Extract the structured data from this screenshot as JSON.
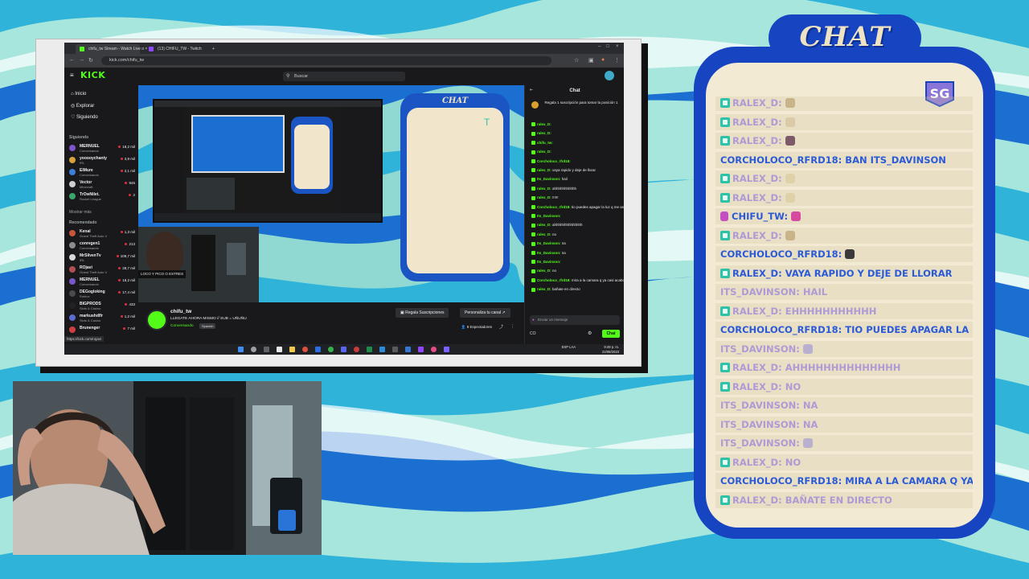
{
  "colors": {
    "accent": "#53fc18",
    "chat_blue": "#1745c2",
    "chat_cream": "#f2ead3",
    "name_blue": "#2b5ad6",
    "name_faded": "#ae9ad4"
  },
  "browser": {
    "tabs": [
      {
        "label": "chifu_tw Stream - Watch Live o ×",
        "icon": "kick-tab-icon"
      },
      {
        "label": "(13) CHIFU_TW - Twitch",
        "icon": "twitch-tab-icon"
      }
    ],
    "new_tab": "+",
    "url": "kick.com/chifu_tw",
    "status_url": "https://kick.com/rojavi"
  },
  "kick": {
    "logo": "KICK",
    "search_placeholder": "Buscar",
    "menu_main": [
      "Inicio",
      "Explorar",
      "Siguiendo"
    ],
    "following_heading": "Siguiendo",
    "following": [
      {
        "name": "MERNUEL",
        "game": "Conversando",
        "viewers": "18,2 mil",
        "color": "#7a56c8"
      },
      {
        "name": "yooooychanty",
        "game": "IRL",
        "viewers": "3,9 mil",
        "color": "#d8a23a"
      },
      {
        "name": "ElMure",
        "game": "Conversando",
        "viewers": "2,1 mil",
        "color": "#3e7dd8"
      },
      {
        "name": "Vector",
        "game": "Minecraft",
        "viewers": "945",
        "color": "#cfcfcf"
      },
      {
        "name": "TrOwNilet.",
        "game": "Rocket League",
        "viewers": "2",
        "color": "#3aa86a"
      }
    ],
    "show_more": "Mostrar más",
    "recommended_heading": "Recomendado",
    "recommended": [
      {
        "name": "Kenal",
        "game": "Grand Theft Auto V",
        "viewers": "1,3 mil",
        "color": "#c8563d"
      },
      {
        "name": "conregen1",
        "game": "Conversando",
        "viewers": "213",
        "color": "#8d8d8d"
      },
      {
        "name": "MrSilvenTv",
        "game": "IRL",
        "viewers": "109,7 mil",
        "color": "#d8d8d8"
      },
      {
        "name": "ROjavi",
        "game": "Grand Theft Auto V",
        "viewers": "28,7 mil",
        "color": "#b05050"
      },
      {
        "name": "MERNUEL",
        "game": "Conversando",
        "viewers": "18,2 mil",
        "color": "#7a56c8"
      },
      {
        "name": "DEGogloking",
        "game": "Roblox",
        "viewers": "17,4 mil",
        "color": "#4a4a4a"
      },
      {
        "name": "BIGPRODS",
        "game": "Slots & Casino",
        "viewers": "433",
        "color": "#222222"
      },
      {
        "name": "markushdlfr",
        "game": "Slots & Casino",
        "viewers": "1,2 mil",
        "color": "#5b6bd0"
      },
      {
        "name": "Brunenger",
        "game": "",
        "viewers": "7 mil",
        "color": "#d04040"
      }
    ],
    "overlay_label": "LOCO Y PICO O ESTRES",
    "channel": {
      "name": "chifu_tw",
      "title": "LLEGATE AHORA MISMO // SUB = UÑUÑU",
      "category": "Conversando",
      "tag": "Spanish",
      "viewers": "8 Espectadores"
    },
    "buttons": {
      "gift": "Regala Suscripciones",
      "customize": "Personaliza tu canal"
    },
    "chat": {
      "title": "Chat",
      "pinned": "Regala 1 suscripción para tomar la posición 1",
      "messages": [
        {
          "user": "ralex_D:",
          "text": ""
        },
        {
          "user": "ralex_D:",
          "text": ""
        },
        {
          "user": "chifu_tw:",
          "text": ""
        },
        {
          "user": "ralex_D:",
          "text": ""
        },
        {
          "user": "Corcholoco_rfrd18:",
          "text": ""
        },
        {
          "user": "ralex_D:",
          "text": "vaya rapido y deje de llorar"
        },
        {
          "user": "Its_Davinson:",
          "text": "hail"
        },
        {
          "user": "ralex_D:",
          "text": "ahhhhhhhhhhh"
        },
        {
          "user": "ralex_D:",
          "text": "!!!!!!"
        },
        {
          "user": "Corcholoco_rfrd18:",
          "text": "tio puedes apagar la luz q me asustas asi"
        },
        {
          "user": "Its_Davinson:",
          "text": ""
        },
        {
          "user": "ralex_D:",
          "text": "ahhhhhhhhhhhhhh"
        },
        {
          "user": "ralex_D:",
          "text": "no"
        },
        {
          "user": "Its_Davinson:",
          "text": "na"
        },
        {
          "user": "Its_Davinson:",
          "text": "na"
        },
        {
          "user": "Its_Davinson:",
          "text": ""
        },
        {
          "user": "ralex_D:",
          "text": "no"
        },
        {
          "user": "Corcholoco_rfrd18:",
          "text": "mira a la camara q ya casi acabo"
        },
        {
          "user": "ralex_D:",
          "text": "bañate en directo"
        }
      ],
      "input_placeholder": "Enviar un mensaje",
      "send": "Chat",
      "points": "CO"
    },
    "clock": {
      "lang": "ESP\nLAA",
      "time": "9:49 p. m.",
      "date": "22/08/2023"
    }
  },
  "overlay_chat": {
    "title": "CHAT",
    "badge": "SG",
    "messages": [
      {
        "user": "RALEX_D:",
        "text": "",
        "badge": true,
        "faded": true,
        "emote": "#c9b48a"
      },
      {
        "user": "RALEX_D:",
        "text": "",
        "badge": true,
        "faded": true,
        "emote": "#d9cba8"
      },
      {
        "user": "RALEX_D:",
        "text": "",
        "badge": true,
        "faded": true,
        "emote": "#7d5a6a"
      },
      {
        "user": "CORCHOLOCO_RFRD18:",
        "text": "BAN ITS_DAVINSON",
        "badge": false,
        "faded": false,
        "emote": ""
      },
      {
        "user": "RALEX_D:",
        "text": "",
        "badge": true,
        "faded": true,
        "emote": "#e0d2a8"
      },
      {
        "user": "RALEX_D:",
        "text": "",
        "badge": true,
        "faded": true,
        "emote": "#e0d2a8"
      },
      {
        "user": "CHIFU_TW:",
        "text": "",
        "badge": false,
        "faded": false,
        "emote": "#d64aa0"
      },
      {
        "user": "RALEX_D:",
        "text": "",
        "badge": true,
        "faded": true,
        "emote": "#c9b48a"
      },
      {
        "user": "CORCHOLOCO_RFRD18:",
        "text": "",
        "badge": false,
        "faded": false,
        "emote": "#3a3a3a"
      },
      {
        "user": "RALEX_D:",
        "text": "VAYA RAPIDO Y DEJE DE LLORAR",
        "badge": true,
        "faded": false,
        "emote": ""
      },
      {
        "user": "ITS_DAVINSON:",
        "text": "HAIL",
        "badge": false,
        "faded": true,
        "emote": ""
      },
      {
        "user": "RALEX_D:",
        "text": "EHHHHHHHHHHH",
        "badge": true,
        "faded": true,
        "emote": ""
      },
      {
        "user": "CORCHOLOCO_RFRD18:",
        "text": "TIO PUEDES APAGAR LA LUZ Q ME ASUSTAS ASI",
        "badge": false,
        "faded": false,
        "emote": ""
      },
      {
        "user": "ITS_DAVINSON:",
        "text": "",
        "badge": false,
        "faded": true,
        "emote": "#b9b0cf"
      },
      {
        "user": "RALEX_D:",
        "text": "AHHHHHHHHHHHHHH",
        "badge": true,
        "faded": true,
        "emote": ""
      },
      {
        "user": "RALEX_D:",
        "text": "NO",
        "badge": true,
        "faded": true,
        "emote": ""
      },
      {
        "user": "ITS_DAVINSON:",
        "text": "NA",
        "badge": false,
        "faded": true,
        "emote": ""
      },
      {
        "user": "ITS_DAVINSON:",
        "text": "NA",
        "badge": false,
        "faded": true,
        "emote": ""
      },
      {
        "user": "ITS_DAVINSON:",
        "text": "",
        "badge": false,
        "faded": true,
        "emote": "#b9b0cf"
      },
      {
        "user": "RALEX_D:",
        "text": "NO",
        "badge": true,
        "faded": true,
        "emote": ""
      },
      {
        "user": "CORCHOLOCO_RFRD18:",
        "text": "MIRA A LA CAMARA Q YA CASI ACABO",
        "badge": false,
        "faded": false,
        "emote": ""
      },
      {
        "user": "RALEX_D:",
        "text": "BAÑATE EN DIRECTO",
        "badge": true,
        "faded": true,
        "emote": ""
      }
    ]
  }
}
